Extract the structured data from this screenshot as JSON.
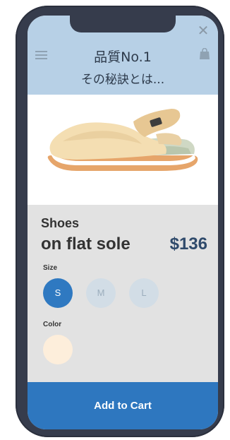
{
  "header": {
    "title": "品質No.1",
    "subtitle": "その秘訣とは..."
  },
  "icons": {
    "close": "close-icon",
    "menu": "hamburger-menu-icon",
    "bag": "shopping-bag-icon"
  },
  "product": {
    "category": "Shoes",
    "name": "on flat sole",
    "price": "$136",
    "image": "beige-slip-on-sneaker"
  },
  "size": {
    "label": "Size",
    "options": [
      "S",
      "M",
      "L"
    ],
    "selected": "S"
  },
  "color": {
    "label": "Color",
    "swatch": "#fdeedb"
  },
  "cart": {
    "label": "Add to Cart"
  },
  "colors": {
    "primary": "#2e77bf",
    "header_bg": "#b7d0e6",
    "details_bg": "#e2e2e2",
    "price": "#2f4a6b"
  }
}
